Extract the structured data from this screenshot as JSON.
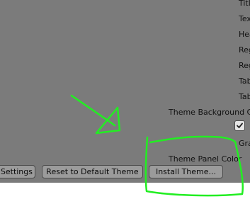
{
  "preferences": {
    "labels_cut": {
      "title": "Titl",
      "text": "Tex",
      "header": "Hea",
      "region1": "Reg",
      "region2": "Reg",
      "tab1": "Tab",
      "tab2": "Tab"
    },
    "theme_background_color": "Theme Background Col",
    "gradient_cut": "Gra",
    "theme_panel_color": "Theme Panel Color",
    "checkbox_checked": true
  },
  "buttons": {
    "settings": "Settings",
    "reset_default_theme": "Reset to Default Theme",
    "install_theme": "Install Theme..."
  },
  "colors": {
    "panel_bg": "#7b7b7b",
    "button_bg": "#9b9b9b",
    "annotation": "#22ee22"
  }
}
